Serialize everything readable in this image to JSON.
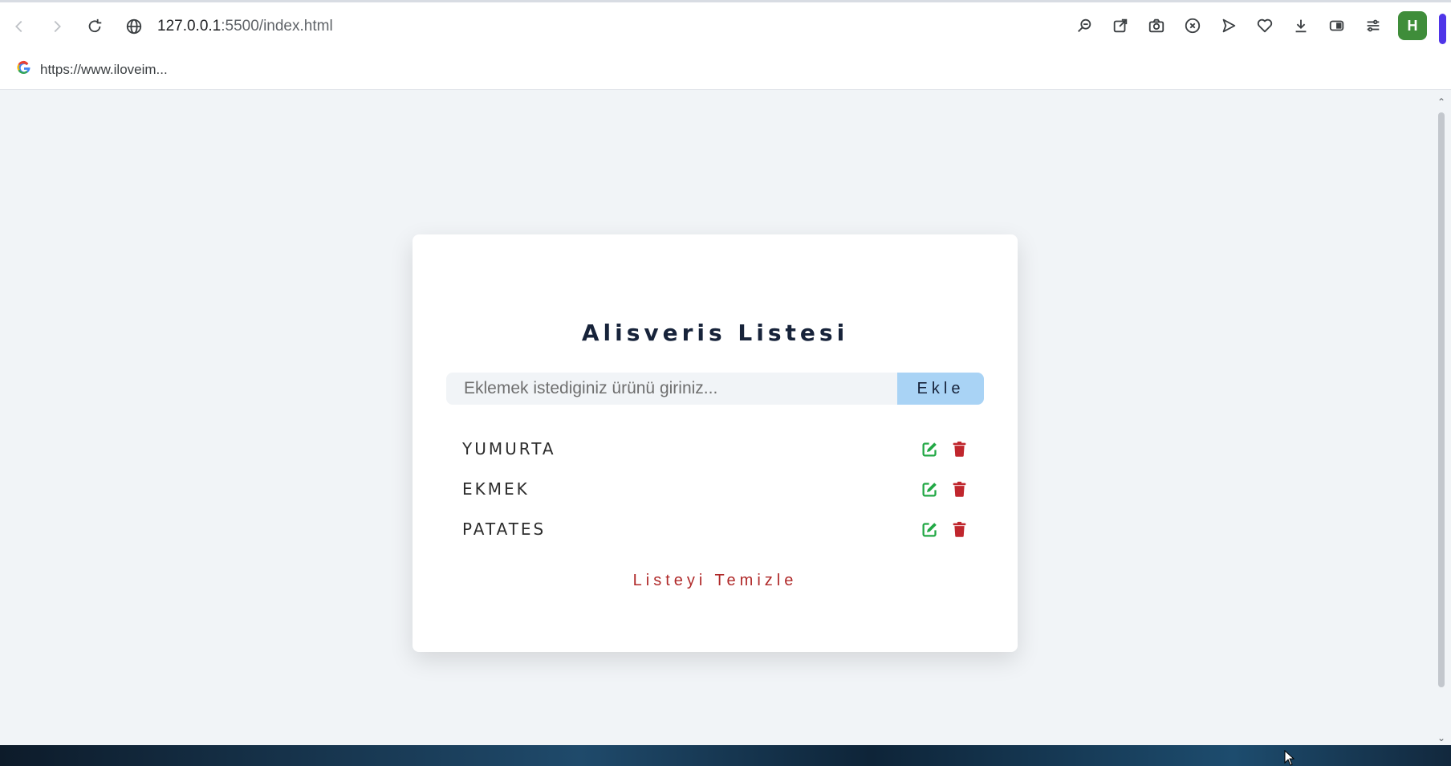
{
  "browser": {
    "url_host": "127.0.0.1",
    "url_path": ":5500/index.html",
    "profile_initial": "H",
    "bookmark_label": "https://www.iloveim..."
  },
  "app": {
    "title": "Alisveris Listesi",
    "input_placeholder": "Eklemek istediginiz ürünü giriniz...",
    "add_button": "Ekle",
    "clear_button": "Listeyi Temizle",
    "items": [
      {
        "name": "YUMURTA"
      },
      {
        "name": "EKMEK"
      },
      {
        "name": "PATATES"
      }
    ]
  },
  "colors": {
    "edit_icon": "#22a845",
    "delete_icon": "#c0262d",
    "add_button_bg": "#a9d3f5",
    "clear_text": "#b02a2a"
  },
  "icons": [
    "back-icon",
    "forward-icon",
    "reload-icon",
    "globe-icon",
    "zoom-icon",
    "share-icon",
    "camera-icon",
    "close-circle-icon",
    "send-icon",
    "heart-icon",
    "download-icon",
    "battery-icon",
    "settings-sliders-icon",
    "edit-icon",
    "trash-icon"
  ]
}
